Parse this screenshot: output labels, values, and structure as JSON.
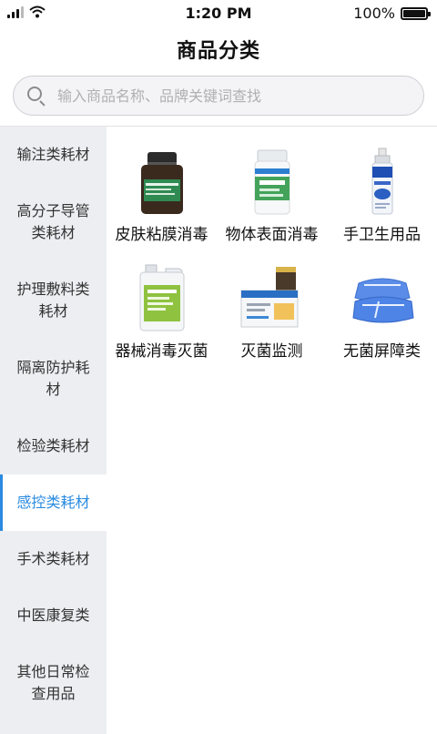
{
  "status_bar": {
    "time": "1:20 PM",
    "battery": "100%"
  },
  "header": {
    "title": "商品分类"
  },
  "search": {
    "placeholder": "输入商品名称、品牌关键词查找"
  },
  "sidebar": {
    "items": [
      {
        "label": "输注类耗材",
        "active": false
      },
      {
        "label": "高分子导管类耗材",
        "active": false
      },
      {
        "label": "护理敷料类耗材",
        "active": false
      },
      {
        "label": "隔离防护耗材",
        "active": false
      },
      {
        "label": "检验类耗材",
        "active": false
      },
      {
        "label": "感控类耗材",
        "active": true
      },
      {
        "label": "手术类耗材",
        "active": false
      },
      {
        "label": "中医康复类",
        "active": false
      },
      {
        "label": "其他日常检查用品",
        "active": false
      }
    ]
  },
  "products": [
    {
      "label": "皮肤粘膜消毒",
      "icon": "brown-bottle-icon"
    },
    {
      "label": "物体表面消毒",
      "icon": "tablet-bottle-icon"
    },
    {
      "label": "手卫生用品",
      "icon": "spray-bottle-icon"
    },
    {
      "label": "器械消毒灭菌",
      "icon": "disinfectant-jug-icon"
    },
    {
      "label": "灭菌监测",
      "icon": "indicator-box-icon"
    },
    {
      "label": "无菌屏障类",
      "icon": "sterile-wrap-icon"
    }
  ],
  "colors": {
    "accent": "#2a8be0",
    "sidebar_bg": "#eceef2"
  }
}
